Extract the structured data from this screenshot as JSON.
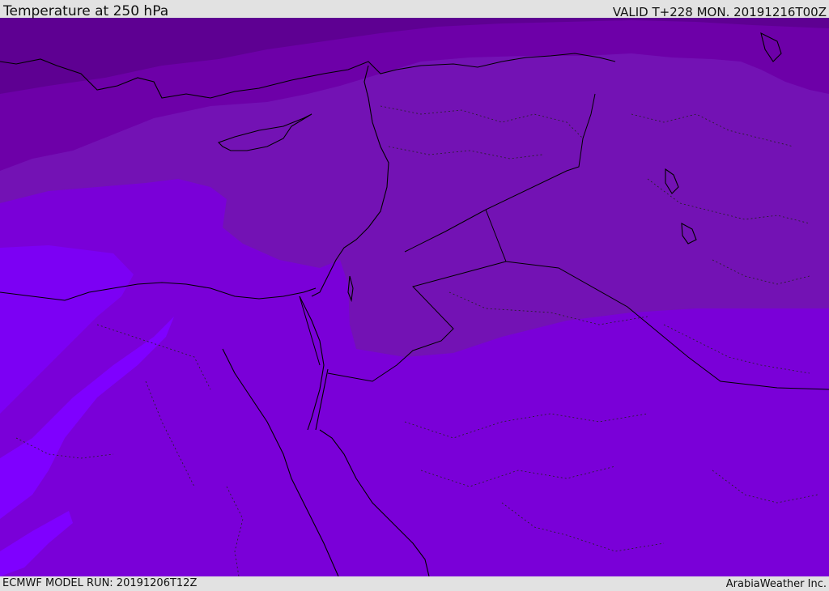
{
  "header": {
    "title": "Temperature at 250 hPa",
    "valid_time": "VALID T+228 MON. 20191216T00Z"
  },
  "footer": {
    "model_run": "ECMWF MODEL RUN: 20191206T12Z",
    "credit": "ArabiaWeather Inc."
  },
  "map": {
    "field": "temperature-250hPa",
    "colors": {
      "band_coldest": "#5e0092",
      "band_cold": "#6d00a8",
      "band_mid_cold": "#7312b4",
      "band_mid": "#7a00d8",
      "band_warm": "#7600ee",
      "band_warmest": "#7f00ff",
      "coastline": "#000000",
      "border": "#000000"
    }
  }
}
